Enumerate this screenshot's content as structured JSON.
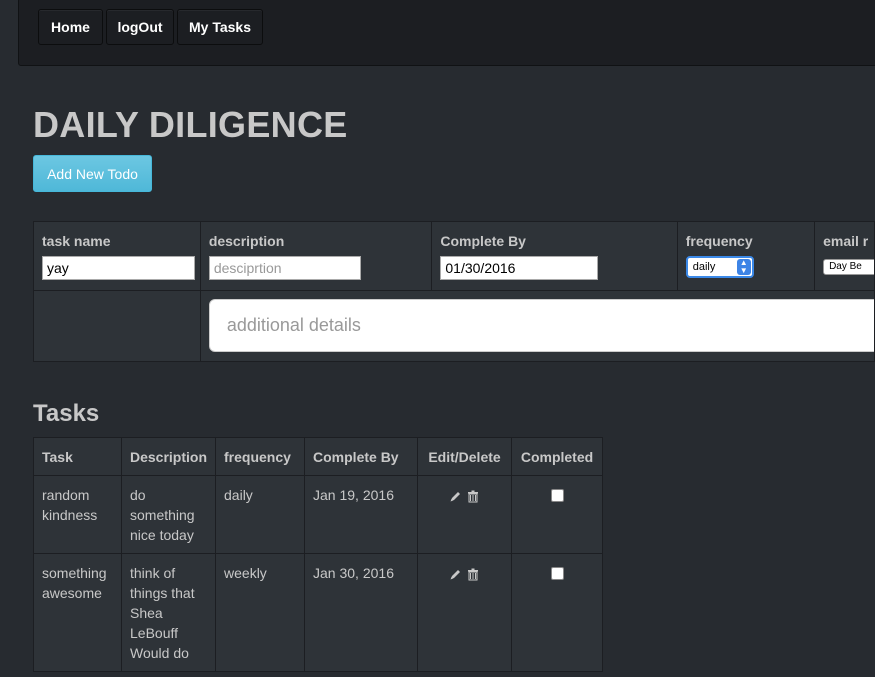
{
  "nav": {
    "home": "Home",
    "logout": "logOut",
    "my_tasks": "My Tasks"
  },
  "page_title": "DAILY DILIGENCE",
  "add_button": "Add New Todo",
  "form": {
    "task_name_label": "task name",
    "task_name_value": "yay",
    "description_label": "description",
    "description_placeholder": "desciprtion",
    "complete_by_label": "Complete By",
    "complete_by_value": "01/30/2016",
    "frequency_label": "frequency",
    "frequency_value": "daily",
    "email_label": "email r",
    "email_value": "Day Be",
    "details_placeholder": "additional details"
  },
  "tasks_heading": "Tasks",
  "tasks_table": {
    "headers": [
      "Task",
      "Description",
      "frequency",
      "Complete By",
      "Edit/Delete",
      "Completed"
    ],
    "rows": [
      {
        "task": "random kindness",
        "description": "do something nice today",
        "frequency": "daily",
        "complete_by": "Jan 19, 2016",
        "completed": false
      },
      {
        "task": "something awesome",
        "description": "think of things that Shea LeBouff Would do",
        "frequency": "weekly",
        "complete_by": "Jan 30, 2016",
        "completed": false
      }
    ]
  },
  "colors": {
    "background": "#272b30",
    "navbar": "#1c1e22",
    "info_button": "#5bc0de",
    "panel": "#2e3338"
  }
}
